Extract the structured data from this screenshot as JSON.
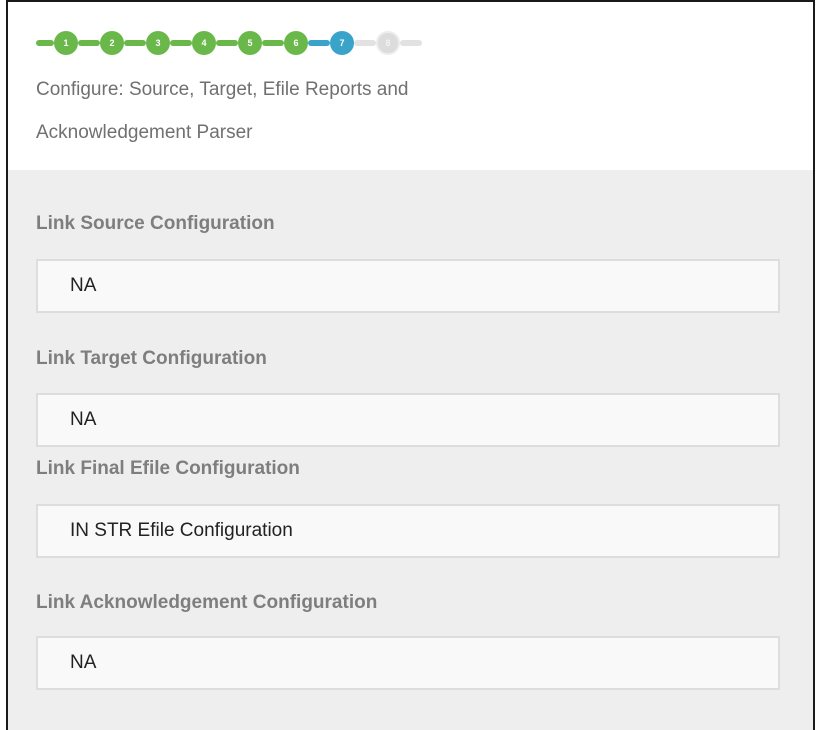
{
  "stepper": {
    "steps": [
      {
        "label": "1",
        "state": "done"
      },
      {
        "label": "2",
        "state": "done"
      },
      {
        "label": "3",
        "state": "done"
      },
      {
        "label": "4",
        "state": "done"
      },
      {
        "label": "5",
        "state": "done"
      },
      {
        "label": "6",
        "state": "done"
      },
      {
        "label": "7",
        "state": "current"
      },
      {
        "label": "8",
        "state": "todo"
      }
    ],
    "colors": {
      "done": "#6ab84a",
      "current": "#3aa3c9",
      "todo": "#dcdcdc"
    }
  },
  "header": {
    "subtitle_line1": "Configure: Source, Target, Efile Reports and",
    "subtitle_line2": "Acknowledgement Parser"
  },
  "fields": [
    {
      "label": "Link Source Configuration",
      "value": "NA"
    },
    {
      "label": "Link Target Configuration",
      "value": "NA"
    },
    {
      "label": "Link Final Efile Configuration",
      "value": "IN STR Efile Configuration"
    },
    {
      "label": "Link Acknowledgement Configuration",
      "value": "NA"
    }
  ]
}
